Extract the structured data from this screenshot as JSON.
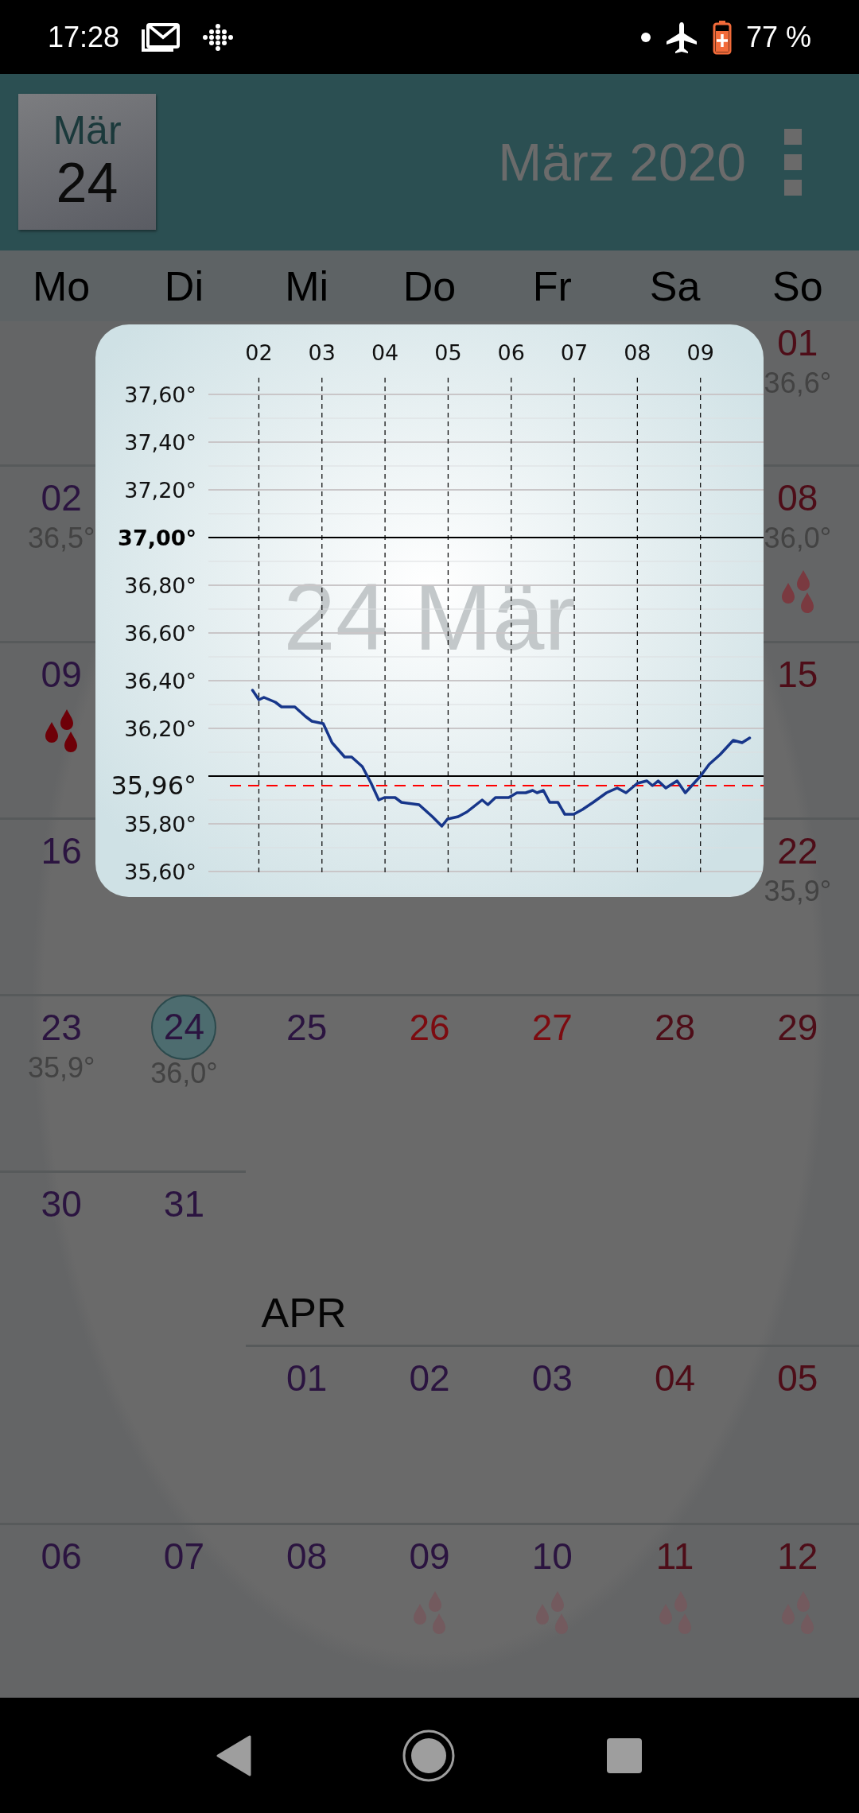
{
  "status_bar": {
    "time": "17:28",
    "battery": "77 %"
  },
  "app_bar": {
    "date_tile": {
      "month": "Mär",
      "day": "24"
    },
    "title": "März 2020"
  },
  "weekdays": [
    "Mo",
    "Di",
    "Mi",
    "Do",
    "Fr",
    "Sa",
    "So"
  ],
  "calendar": {
    "weeks": [
      {
        "days": {
          "so": {
            "day": "01",
            "temp": "36,6°",
            "color": "#4e0d18",
            "selected": false
          }
        }
      },
      {
        "days": {
          "mo": {
            "day": "02",
            "temp": "36,5°",
            "color": "#2b1440",
            "selected": false
          },
          "so": {
            "day": "08",
            "temp": "36,0°",
            "color": "#4e0d18",
            "drops": {
              "color": "#7a3a40"
            },
            "selected": false
          }
        }
      },
      {
        "days": {
          "mo": {
            "day": "09",
            "color": "#2b1440",
            "drops": {
              "color": "#6e0008"
            },
            "selected": false
          },
          "so": {
            "day": "15",
            "color": "#4e0d18",
            "selected": false
          }
        }
      },
      {
        "days": {
          "mo": {
            "day": "16",
            "color": "#2b1440",
            "selected": false
          },
          "so": {
            "day": "22",
            "temp": "35,9°",
            "color": "#4e0d18",
            "selected": false
          }
        }
      },
      {
        "days": {
          "mo": {
            "day": "23",
            "temp": "35,9°",
            "color": "#2b1440",
            "selected": false
          },
          "di": {
            "day": "24",
            "temp": "36,0°",
            "color": "#2b1440",
            "selected": true
          },
          "mi": {
            "day": "25",
            "color": "#2b1440",
            "selected": false
          },
          "do": {
            "day": "26",
            "color": "#7c0b10",
            "selected": false
          },
          "fr": {
            "day": "27",
            "color": "#7c0b10",
            "selected": false
          },
          "sa": {
            "day": "28",
            "color": "#4e0d18",
            "selected": false
          },
          "so": {
            "day": "29",
            "color": "#4e0d18",
            "selected": false
          }
        }
      },
      {
        "month_label": "APR",
        "days": {
          "mo": {
            "day": "30",
            "color": "#2b1440",
            "selected": false
          },
          "di": {
            "day": "31",
            "color": "#2b1440",
            "selected": false
          },
          "mi": {
            "day": "01",
            "color": "#2b1440",
            "selected": false
          },
          "do": {
            "day": "02",
            "color": "#2b1440",
            "selected": false
          },
          "fr": {
            "day": "03",
            "color": "#2b1440",
            "selected": false
          },
          "sa": {
            "day": "04",
            "color": "#4e0d18",
            "selected": false
          },
          "so": {
            "day": "05",
            "color": "#4e0d18",
            "selected": false
          }
        }
      },
      {
        "days": {
          "mo": {
            "day": "06",
            "color": "#2b1440",
            "selected": false
          },
          "di": {
            "day": "07",
            "color": "#2b1440",
            "selected": false
          },
          "mi": {
            "day": "08",
            "color": "#2b1440",
            "selected": false
          },
          "do": {
            "day": "09",
            "color": "#2b1440",
            "drops": {
              "color": "#735a5e"
            },
            "selected": false
          },
          "fr": {
            "day": "10",
            "color": "#2b1440",
            "drops": {
              "color": "#735a5e"
            },
            "selected": false
          },
          "sa": {
            "day": "11",
            "color": "#4e0d18",
            "drops": {
              "color": "#735a5e"
            },
            "selected": false
          },
          "so": {
            "day": "12",
            "color": "#4e0d18",
            "drops": {
              "color": "#735a5e"
            },
            "selected": false
          }
        }
      }
    ]
  },
  "popup": {
    "watermark": "24 Mär",
    "chart_data": {
      "type": "line",
      "grid": true,
      "xlim": [
        1.2,
        10
      ],
      "ylim": [
        35.5,
        37.6
      ],
      "xticks": [
        {
          "value": 2,
          "label": "02"
        },
        {
          "value": 3,
          "label": "03"
        },
        {
          "value": 4,
          "label": "04"
        },
        {
          "value": 5,
          "label": "05"
        },
        {
          "value": 6,
          "label": "06"
        },
        {
          "value": 7,
          "label": "07"
        },
        {
          "value": 8,
          "label": "08"
        },
        {
          "value": 9,
          "label": "09"
        }
      ],
      "yticks": [
        {
          "value": 37.6,
          "label": "37,60°"
        },
        {
          "value": 37.4,
          "label": "37,40°"
        },
        {
          "value": 37.2,
          "label": "37,20°"
        },
        {
          "value": 37.0,
          "label": "37,00°"
        },
        {
          "value": 36.8,
          "label": "36,80°"
        },
        {
          "value": 36.6,
          "label": "36,60°"
        },
        {
          "value": 36.4,
          "label": "36,40°"
        },
        {
          "value": 36.2,
          "label": "36,20°"
        },
        {
          "value": 35.8,
          "label": "35,80°"
        },
        {
          "value": 35.6,
          "label": "35,60°"
        }
      ],
      "x": [
        1.9,
        2.0,
        2.08,
        2.26,
        2.36,
        2.57,
        2.74,
        2.84,
        3.02,
        3.16,
        3.36,
        3.47,
        3.64,
        3.78,
        3.9,
        3.99,
        4.16,
        4.26,
        4.54,
        4.75,
        4.9,
        4.99,
        5.16,
        5.3,
        5.54,
        5.63,
        5.75,
        5.96,
        6.09,
        6.23,
        6.34,
        6.41,
        6.51,
        6.61,
        6.74,
        6.85,
        6.99,
        7.13,
        7.3,
        7.51,
        7.68,
        7.82,
        8.0,
        8.15,
        8.24,
        8.33,
        8.45,
        8.63,
        8.76,
        9.0,
        9.14,
        9.31,
        9.52,
        9.66,
        9.78
      ],
      "series": [
        {
          "color": "#17368a",
          "values": [
            36.36,
            36.32,
            36.33,
            36.31,
            36.29,
            36.29,
            36.25,
            36.23,
            36.22,
            36.14,
            36.08,
            36.08,
            36.04,
            35.97,
            35.9,
            35.91,
            35.91,
            35.89,
            35.88,
            35.83,
            35.79,
            35.82,
            35.83,
            35.85,
            35.9,
            35.88,
            35.91,
            35.91,
            35.93,
            35.93,
            35.94,
            35.93,
            35.94,
            35.89,
            35.89,
            35.84,
            35.84,
            35.86,
            35.89,
            35.93,
            35.95,
            35.93,
            35.97,
            35.98,
            35.96,
            35.98,
            35.95,
            35.98,
            35.93,
            36.0,
            36.05,
            36.09,
            36.15,
            36.14,
            36.16
          ]
        }
      ],
      "ref_lines": [
        {
          "axis": "y",
          "value": 37.0,
          "color": "#000000"
        },
        {
          "axis": "y",
          "value": 36.0,
          "color": "#000000"
        },
        {
          "axis": "y",
          "value": 35.96,
          "color": "#ff0000",
          "label": "35,96°"
        }
      ]
    }
  }
}
